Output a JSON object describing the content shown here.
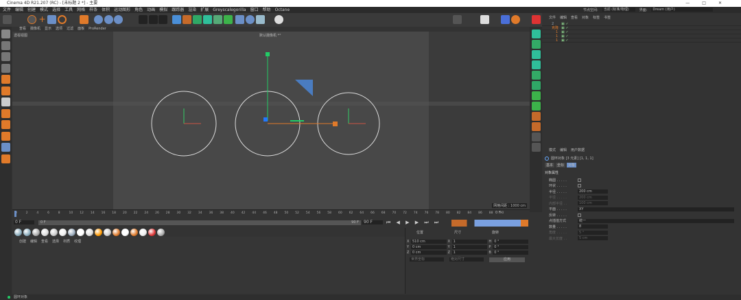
{
  "window": {
    "title": "Cinema 4D R21.207 (RC) - [未标题 2 *] - 主要"
  },
  "menu": [
    "文件",
    "编辑",
    "创建",
    "模式",
    "选择",
    "工具",
    "网格",
    "样条",
    "体积",
    "运动图形",
    "角色",
    "动画",
    "模拟",
    "跟踪器",
    "渲染",
    "扩展",
    "Greyscalegorilla",
    "窗口",
    "帮助",
    "Octane"
  ],
  "layout": {
    "node_space_label": "节点空间:",
    "node_space_value": "当前 (标准/物理)",
    "interface_label": "界面:",
    "interface_value": "Dream (用户)"
  },
  "viewport": {
    "menu": [
      "查看",
      "摄像机",
      "显示",
      "选项",
      "过滤",
      "面板",
      "ProRender"
    ],
    "name": "透视视图",
    "camera": "默认摄像机 *°",
    "grid": "网格间距 : 1000 cm"
  },
  "object_manager": {
    "menu": [
      "文件",
      "编辑",
      "查看",
      "对象",
      "标签",
      "书签"
    ],
    "objects": [
      {
        "name": "2",
        "color": "#9ab"
      },
      {
        "name": "克隆",
        "color": "#e07a2a"
      },
      {
        "name": "1",
        "color": "#e07a2a"
      },
      {
        "name": "1",
        "color": "#e07a2a"
      },
      {
        "name": "1",
        "color": "#e07a2a"
      }
    ]
  },
  "attributes": {
    "menu": [
      "模式",
      "编辑",
      "用户数据"
    ],
    "object_title": "圆环对象 [3 元素] [1, 1, 1]",
    "tabs": [
      "基本",
      "坐标",
      "对象"
    ],
    "active_tab": "对象",
    "section": "对象属性",
    "props": [
      {
        "label": "椭圆 . . . . .",
        "type": "check"
      },
      {
        "label": "环状 . . . . .",
        "type": "check"
      },
      {
        "label": "半径 . . . . .",
        "value": "200 cm"
      },
      {
        "label": "半径 . . . . .",
        "value": "200 cm",
        "disabled": true
      },
      {
        "label": "内部半径 . .",
        "value": "100 cm",
        "disabled": true
      },
      {
        "label": "平面 . . . . .",
        "value": "XY",
        "wide": true
      },
      {
        "label": "反转 . . . . .",
        "type": "check"
      },
      {
        "label": "点插值方式",
        "value": "统一",
        "wide": true
      },
      {
        "label": "数量 . . . . .",
        "value": "8"
      },
      {
        "label": "角度 . . . . .",
        "value": "5 °",
        "disabled": true
      },
      {
        "label": "最大长度 . .",
        "value": "5 cm",
        "disabled": true
      }
    ]
  },
  "timeline": {
    "ticks": [
      0,
      2,
      4,
      6,
      8,
      10,
      12,
      14,
      16,
      18,
      20,
      22,
      24,
      26,
      28,
      30,
      32,
      34,
      36,
      38,
      40,
      42,
      44,
      46,
      48,
      50,
      52,
      54,
      56,
      58,
      60,
      62,
      64,
      66,
      68,
      70,
      72,
      74,
      76,
      78,
      80,
      82,
      84,
      86,
      88,
      90
    ],
    "current": "0 F",
    "start": "0 F",
    "range_start": "0 F",
    "range_end": "90 F",
    "end": "90 F"
  },
  "materials": {
    "menu": [
      "创建",
      "编辑",
      "查看",
      "选择",
      "材质",
      "纹理"
    ]
  },
  "coordinates": {
    "headers": [
      "位置",
      "尺寸",
      "旋转"
    ],
    "rows": [
      [
        "X",
        "510 cm",
        "X",
        "1",
        "H",
        "0 °"
      ],
      [
        "Y",
        "0 cm",
        "Y",
        "1",
        "P",
        "0 °"
      ],
      [
        "Z",
        "0 cm",
        "Z",
        "1",
        "B",
        "0 °"
      ]
    ],
    "mode1": "世界坐标",
    "mode2": "绝对尺寸",
    "apply": "应用"
  },
  "status": {
    "text": "圆环对象"
  }
}
